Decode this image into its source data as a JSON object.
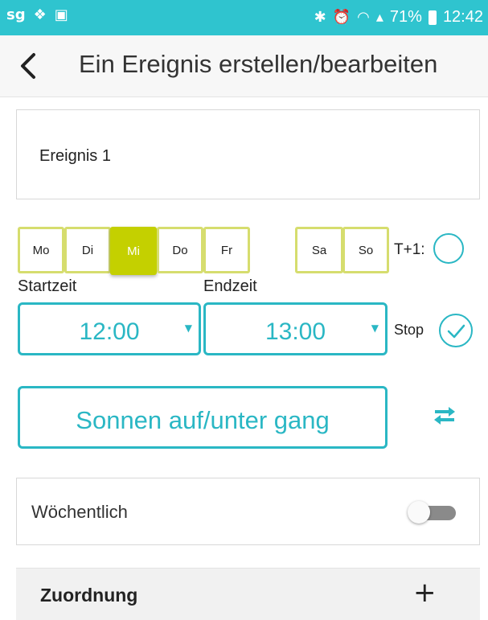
{
  "status_bar": {
    "left_icons": [
      "sg-icon",
      "dropbox-icon",
      "image-icon"
    ],
    "battery": "71%",
    "time": "12:42"
  },
  "header": {
    "title": "Ein Ereignis erstellen/bearbeiten"
  },
  "event": {
    "name": "Ereignis 1"
  },
  "days": [
    {
      "label": "Mo",
      "selected": false
    },
    {
      "label": "Di",
      "selected": false
    },
    {
      "label": "Mi",
      "selected": true
    },
    {
      "label": "Do",
      "selected": false
    },
    {
      "label": "Fr",
      "selected": false
    },
    {
      "label": "Sa",
      "selected": false
    },
    {
      "label": "So",
      "selected": false
    }
  ],
  "next_day": {
    "label": "T+1:",
    "checked": false
  },
  "times": {
    "start_label": "Startzeit",
    "start_value": "12:00",
    "end_label": "Endzeit",
    "end_value": "13:00",
    "stop_label": "Stop",
    "stop_checked": true
  },
  "sun_button": {
    "label": "Sonnen auf/unter gang"
  },
  "weekly": {
    "label": "Wöchentlich",
    "enabled": false
  },
  "assignment": {
    "label": "Zuordnung",
    "add": "+"
  },
  "colors": {
    "accent": "#2ab7c4",
    "status_bar": "#2fc4cf",
    "day_border": "#d6dd6e",
    "day_selected": "#c4d000"
  }
}
